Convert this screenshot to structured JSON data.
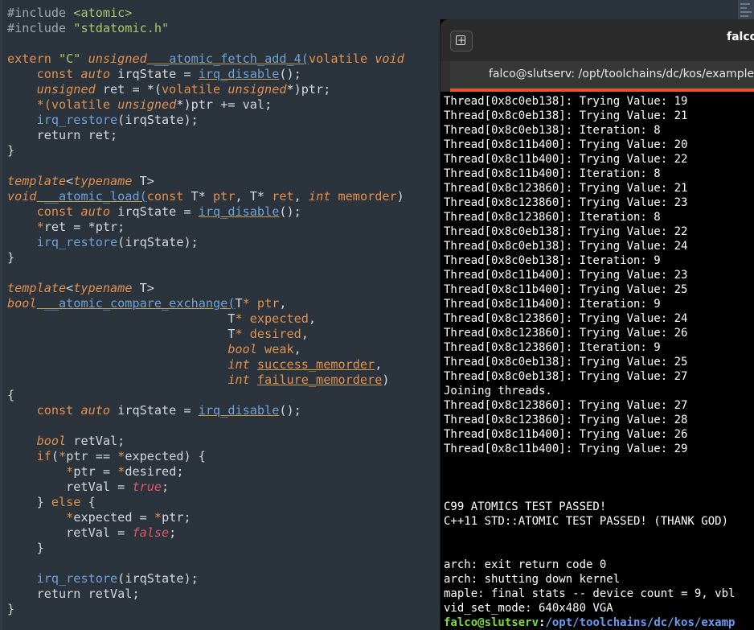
{
  "editor": {
    "lines": [
      [
        [
          "#include ",
          "pp"
        ],
        [
          "<atomic>",
          "str"
        ]
      ],
      [
        [
          "#include ",
          "pp"
        ],
        [
          "\"stdatomic.h\"",
          "str"
        ]
      ],
      [],
      [
        [
          "extern ",
          "kw"
        ],
        [
          "\"C\"",
          "str"
        ],
        [
          " ",
          ""
        ],
        [
          "unsigned",
          "it"
        ],
        [
          " __atomic_fetch_add_4(",
          "fnu"
        ],
        [
          "volatile",
          "kw"
        ],
        [
          " ",
          ""
        ],
        [
          "void",
          "it"
        ]
      ],
      [
        [
          "    ",
          ""
        ],
        [
          "const",
          "kw"
        ],
        [
          " ",
          ""
        ],
        [
          "auto",
          "it"
        ],
        [
          " irqState = ",
          ""
        ],
        [
          "irq_disable",
          "fnu"
        ],
        [
          "();",
          ""
        ]
      ],
      [
        [
          "    ",
          ""
        ],
        [
          "unsigned",
          "it"
        ],
        [
          " ret = *(",
          ""
        ],
        [
          "volatile",
          "kw"
        ],
        [
          " ",
          ""
        ],
        [
          "unsigned",
          "it"
        ],
        [
          "*)ptr;",
          ""
        ]
      ],
      [
        [
          "    ",
          ""
        ],
        [
          "*(",
          "kw"
        ],
        [
          "volatile",
          "kw"
        ],
        [
          " ",
          ""
        ],
        [
          "unsigned",
          "it"
        ],
        [
          "*)ptr += val;",
          ""
        ]
      ],
      [
        [
          "    ",
          ""
        ],
        [
          "irq_restore",
          "fn"
        ],
        [
          "(irqState);",
          ""
        ]
      ],
      [
        [
          "    return ret;",
          ""
        ]
      ],
      [
        [
          "}",
          ""
        ]
      ],
      [],
      [
        [
          "template",
          "it"
        ],
        [
          "<",
          ""
        ],
        [
          "typename",
          "it"
        ],
        [
          " T>",
          ""
        ]
      ],
      [
        [
          "void",
          "it"
        ],
        [
          " __atomic_load(",
          "fnu"
        ],
        [
          "const",
          "kw"
        ],
        [
          " T* ",
          ""
        ],
        [
          "ptr",
          "kw"
        ],
        [
          ", T* ",
          ""
        ],
        [
          "ret",
          "kw"
        ],
        [
          ", ",
          ""
        ],
        [
          "int",
          "it"
        ],
        [
          " ",
          ""
        ],
        [
          "memorder",
          "kw"
        ],
        [
          ")",
          ""
        ]
      ],
      [
        [
          "    ",
          ""
        ],
        [
          "const",
          "kw"
        ],
        [
          " ",
          ""
        ],
        [
          "auto",
          "it"
        ],
        [
          " irqState = ",
          ""
        ],
        [
          "irq_disable",
          "fnu"
        ],
        [
          "();",
          ""
        ]
      ],
      [
        [
          "    ",
          ""
        ],
        [
          "*",
          "kw"
        ],
        [
          "ret = *ptr;",
          ""
        ]
      ],
      [
        [
          "    ",
          ""
        ],
        [
          "irq_restore",
          "fn"
        ],
        [
          "(irqState);",
          ""
        ]
      ],
      [
        [
          "}",
          ""
        ]
      ],
      [],
      [
        [
          "template",
          "it"
        ],
        [
          "<",
          ""
        ],
        [
          "typename",
          "it"
        ],
        [
          " T>",
          ""
        ]
      ],
      [
        [
          "bool",
          "it"
        ],
        [
          " __atomic_compare_exchange(",
          "fnu"
        ],
        [
          "T",
          ""
        ],
        [
          "* ",
          "kw"
        ],
        [
          "ptr",
          "kw"
        ],
        [
          ",",
          ""
        ]
      ],
      [
        [
          "                              T",
          ""
        ],
        [
          "* ",
          "kw"
        ],
        [
          "expected",
          "kw"
        ],
        [
          ",",
          ""
        ]
      ],
      [
        [
          "                              T",
          ""
        ],
        [
          "* ",
          "kw"
        ],
        [
          "desired",
          "kw"
        ],
        [
          ",",
          ""
        ]
      ],
      [
        [
          "                              ",
          ""
        ],
        [
          "bool",
          "it"
        ],
        [
          " ",
          ""
        ],
        [
          "weak",
          "kw"
        ],
        [
          ",",
          ""
        ]
      ],
      [
        [
          "                              ",
          ""
        ],
        [
          "int",
          "it"
        ],
        [
          " ",
          ""
        ],
        [
          "success_memorder",
          "kwu"
        ],
        [
          ",",
          ""
        ]
      ],
      [
        [
          "                              ",
          ""
        ],
        [
          "int",
          "it"
        ],
        [
          " ",
          ""
        ],
        [
          "failure_memordere",
          "kwu"
        ],
        [
          ")",
          ""
        ]
      ],
      [
        [
          "{",
          ""
        ]
      ],
      [
        [
          "    ",
          ""
        ],
        [
          "const",
          "kw"
        ],
        [
          " ",
          ""
        ],
        [
          "auto",
          "it"
        ],
        [
          " irqState = ",
          ""
        ],
        [
          "irq_disable",
          "fnu"
        ],
        [
          "();",
          ""
        ]
      ],
      [],
      [
        [
          "    ",
          ""
        ],
        [
          "bool",
          "it"
        ],
        [
          " retVal;",
          ""
        ]
      ],
      [
        [
          "    ",
          ""
        ],
        [
          "if",
          "kw"
        ],
        [
          "(",
          ""
        ],
        [
          "*",
          "kw"
        ],
        [
          "ptr == ",
          ""
        ],
        [
          "*",
          "kw"
        ],
        [
          "expected) {",
          ""
        ]
      ],
      [
        [
          "        ",
          ""
        ],
        [
          "*",
          "kw"
        ],
        [
          "ptr = ",
          ""
        ],
        [
          "*",
          "kw"
        ],
        [
          "desired;",
          ""
        ]
      ],
      [
        [
          "        retVal = ",
          ""
        ],
        [
          "true",
          "bool"
        ],
        [
          ";",
          ""
        ]
      ],
      [
        [
          "    } ",
          ""
        ],
        [
          "else",
          "kw"
        ],
        [
          " {",
          ""
        ]
      ],
      [
        [
          "        ",
          ""
        ],
        [
          "*",
          "kw"
        ],
        [
          "expected = ",
          ""
        ],
        [
          "*",
          "kw"
        ],
        [
          "ptr;",
          ""
        ]
      ],
      [
        [
          "        retVal = ",
          ""
        ],
        [
          "false",
          "bool"
        ],
        [
          ";",
          ""
        ]
      ],
      [
        [
          "    }",
          ""
        ]
      ],
      [],
      [
        [
          "    ",
          ""
        ],
        [
          "irq_restore",
          "fn"
        ],
        [
          "(irqState);",
          ""
        ]
      ],
      [
        [
          "    return retVal;",
          ""
        ]
      ],
      [
        [
          "}",
          ""
        ]
      ]
    ]
  },
  "terminal": {
    "title": "falco",
    "tab_label": "falco@slutserv: /opt/toolchains/dc/kos/examples/",
    "output_lines": [
      "Thread[0x8c0eb138]: Trying Value: 19",
      "Thread[0x8c0eb138]: Trying Value: 21",
      "Thread[0x8c0eb138]: Iteration: 8",
      "Thread[0x8c11b400]: Trying Value: 20",
      "Thread[0x8c11b400]: Trying Value: 22",
      "Thread[0x8c11b400]: Iteration: 8",
      "Thread[0x8c123860]: Trying Value: 21",
      "Thread[0x8c123860]: Trying Value: 23",
      "Thread[0x8c123860]: Iteration: 8",
      "Thread[0x8c0eb138]: Trying Value: 22",
      "Thread[0x8c0eb138]: Trying Value: 24",
      "Thread[0x8c0eb138]: Iteration: 9",
      "Thread[0x8c11b400]: Trying Value: 23",
      "Thread[0x8c11b400]: Trying Value: 25",
      "Thread[0x8c11b400]: Iteration: 9",
      "Thread[0x8c123860]: Trying Value: 24",
      "Thread[0x8c123860]: Trying Value: 26",
      "Thread[0x8c123860]: Iteration: 9",
      "Thread[0x8c0eb138]: Trying Value: 25",
      "Thread[0x8c0eb138]: Trying Value: 27",
      "Joining threads.",
      "Thread[0x8c123860]: Trying Value: 27",
      "Thread[0x8c123860]: Trying Value: 28",
      "Thread[0x8c11b400]: Trying Value: 26",
      "Thread[0x8c11b400]: Trying Value: 29",
      "",
      "",
      "",
      "C99 ATOMICS TEST PASSED!",
      "C++11 STD::ATOMIC TEST PASSED! (THANK GOD)",
      "",
      "",
      "arch: exit return code 0",
      "arch: shutting down kernel",
      "maple: final stats -- device count = 9, vbl",
      "vid_set_mode: 640x480 VGA"
    ],
    "prompt": {
      "user_host": "falco@slutserv",
      "separator": ":",
      "path": "/opt/toolchains/dc/kos/examp"
    }
  },
  "colors": {
    "editor_bg": "#2b333d",
    "keyword": "#e3914d",
    "string": "#a6c96a",
    "function": "#6fa3d6",
    "bool_literal": "#e0566b",
    "terminal_bg": "#000000",
    "terminal_accent": "#e95420",
    "prompt_user": "#7ddc3b",
    "prompt_path": "#6b9bf0"
  }
}
